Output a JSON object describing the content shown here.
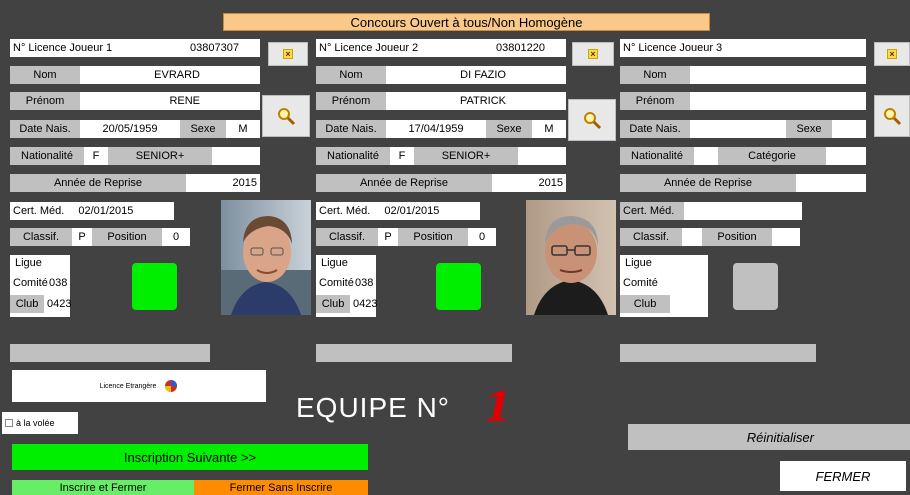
{
  "header": {
    "title": "Concours Ouvert à tous/Non Homogène"
  },
  "players": [
    {
      "licence_label": "N° Licence Joueur 1",
      "licence": "03807307",
      "nom_label": "Nom",
      "nom": "EVRARD",
      "prenom_label": "Prénom",
      "prenom": "RENE",
      "date_label": "Date Nais.",
      "date": "20/05/1959",
      "sexe_label": "Sexe",
      "sexe": "M",
      "nat_label": "Nationalité",
      "nat": "F",
      "categorie": "SENIOR+",
      "reprise_label": "Année de Reprise",
      "reprise": "2015",
      "cert_label": "Cert. Méd.",
      "cert": "02/01/2015",
      "classif_label": "Classif.",
      "classif": "P",
      "position_label": "Position",
      "position": "0",
      "ligue_label": "Ligue",
      "ligue": "",
      "comite_label": "Comité",
      "comite": "038",
      "club_label": "Club",
      "club": "0423",
      "status_color": "#00ee00"
    },
    {
      "licence_label": "N° Licence Joueur 2",
      "licence": "03801220",
      "nom_label": "Nom",
      "nom": "DI FAZIO",
      "prenom_label": "Prénom",
      "prenom": "PATRICK",
      "date_label": "Date Nais.",
      "date": "17/04/1959",
      "sexe_label": "Sexe",
      "sexe": "M",
      "nat_label": "Nationalité",
      "nat": "F",
      "categorie": "SENIOR+",
      "reprise_label": "Année de Reprise",
      "reprise": "2015",
      "cert_label": "Cert. Méd.",
      "cert": "02/01/2015",
      "classif_label": "Classif.",
      "classif": "P",
      "position_label": "Position",
      "position": "0",
      "ligue_label": "Ligue",
      "ligue": "",
      "comite_label": "Comité",
      "comite": "038",
      "club_label": "Club",
      "club": "0423",
      "status_color": "#00ee00"
    },
    {
      "licence_label": "N° Licence Joueur 3",
      "licence": "",
      "nom_label": "Nom",
      "nom": "",
      "prenom_label": "Prénom",
      "prenom": "",
      "date_label": "Date Nais.",
      "date": "",
      "sexe_label": "Sexe",
      "sexe": "",
      "nat_label": "Nationalité",
      "nat": "",
      "categorie": "Catégorie",
      "reprise_label": "Année de Reprise",
      "reprise": "",
      "cert_label": "Cert. Méd.",
      "cert": "",
      "classif_label": "Classif.",
      "classif": "",
      "position_label": "Position",
      "position": "",
      "ligue_label": "Ligue",
      "ligue": "",
      "comite_label": "Comité",
      "comite": "",
      "club_label": "Club",
      "club": "",
      "status_color": "#c0c0c0"
    }
  ],
  "licence_etrangere": "Licence Etrangère",
  "a_la_volee": "à la volée",
  "equipe_label": "EQUIPE N°",
  "equipe_num": "1",
  "buttons": {
    "inscription_suivante": "Inscription Suivante >>",
    "inscrire_fermer": "Inscrire et Fermer",
    "fermer_sans": "Fermer Sans Inscrire",
    "reinitialiser": "Réinitialiser",
    "fermer": "FERMER"
  },
  "icons": {
    "clear": "clear-x-icon",
    "search": "magnifier-icon"
  },
  "colors": {
    "green": "#00ee00",
    "orange": "#ff8c00",
    "lightgreen": "#66ee66",
    "title_bg": "#fac98a",
    "equipe_num": "#e00000"
  }
}
